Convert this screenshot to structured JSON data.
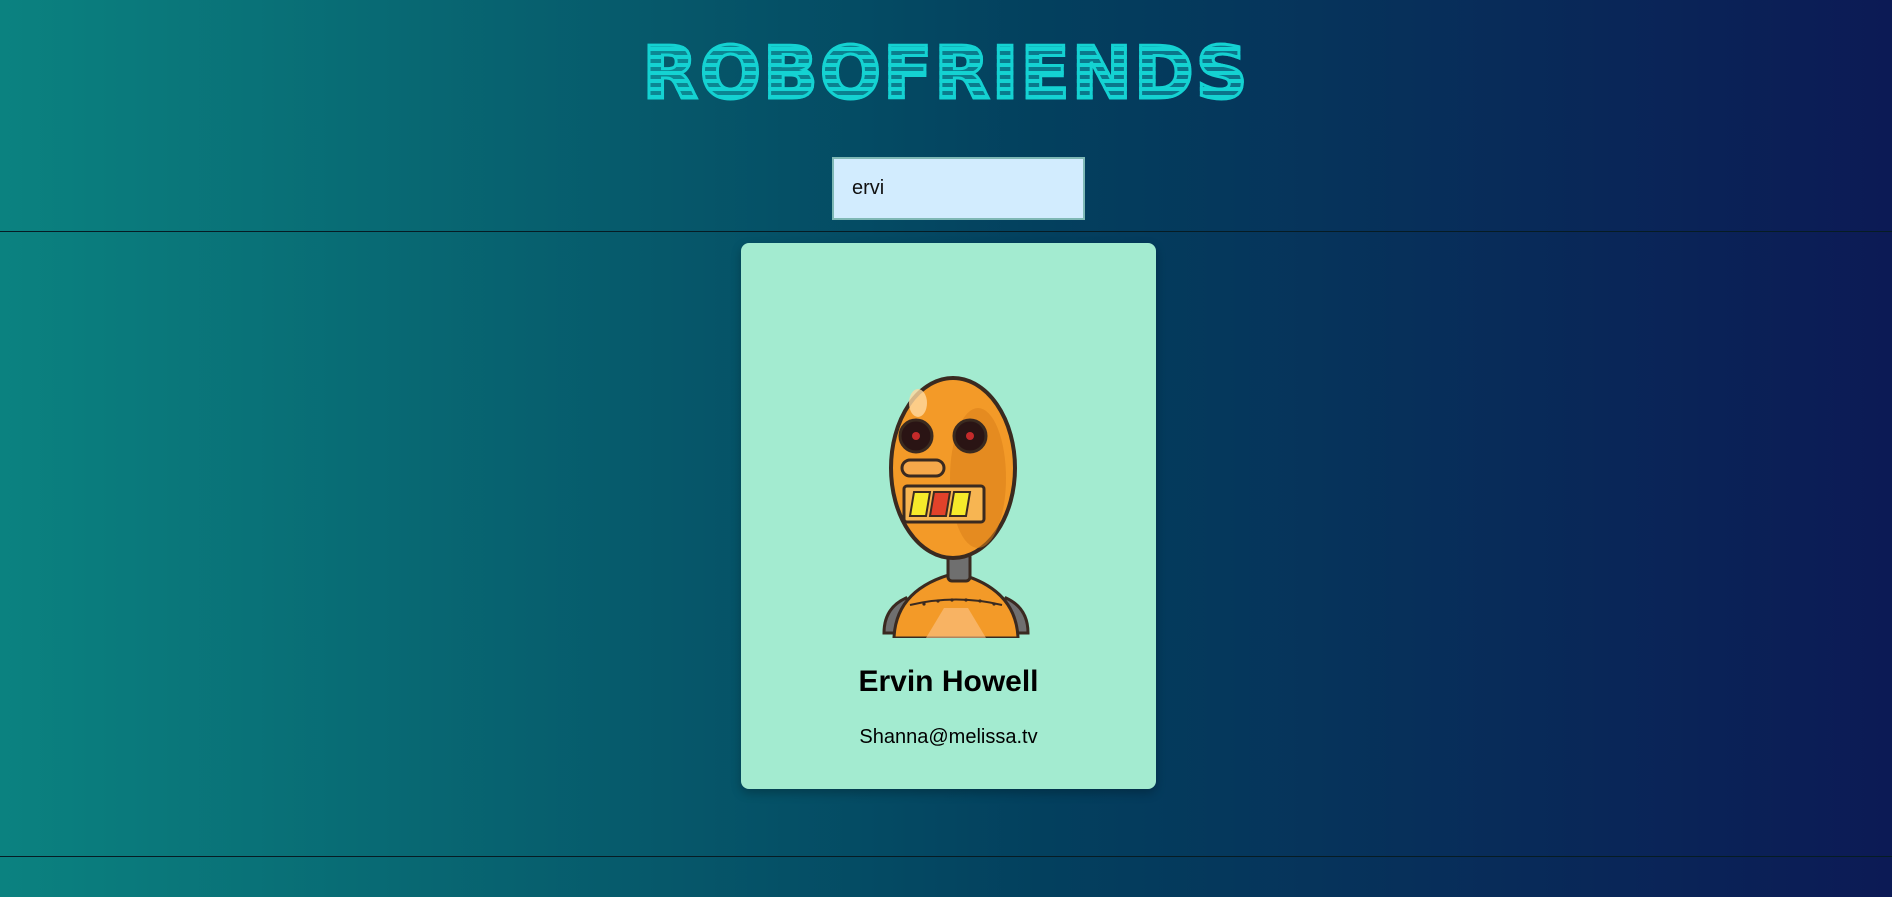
{
  "header": {
    "title": "ROBOFRIENDS"
  },
  "search": {
    "value": "ervi",
    "placeholder": "search robots"
  },
  "robots": [
    {
      "name": "Ervin Howell",
      "email": "Shanna@melissa.tv"
    }
  ],
  "colors": {
    "background_start": "#0b8280",
    "background_end": "#0c1a55",
    "title": "#14d2d2",
    "card": "#a3ebd0",
    "search_bg": "#d2ecfe"
  }
}
